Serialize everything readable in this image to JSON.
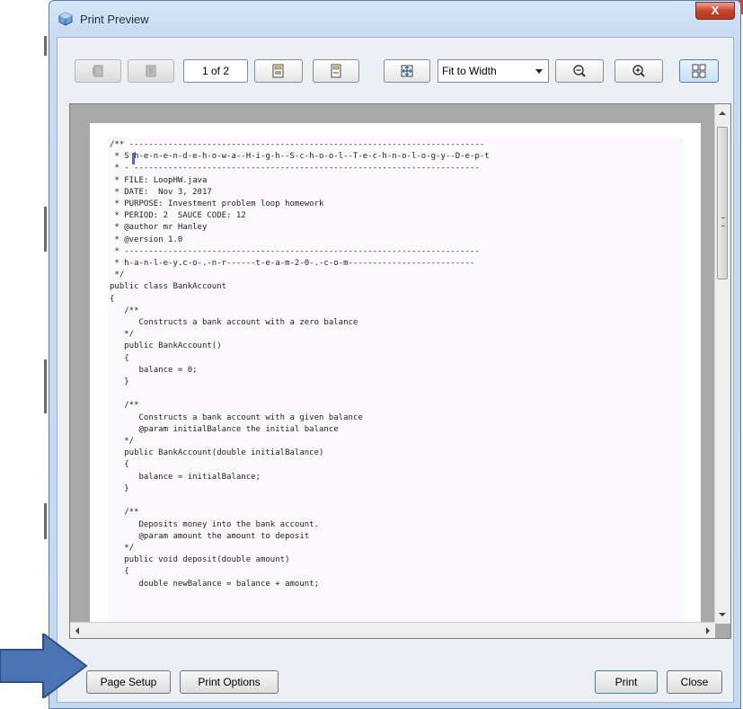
{
  "window": {
    "title": "Print Preview",
    "close_label": "X"
  },
  "toolbar": {
    "page_indicator": "1 of 2",
    "zoom_selected": "Fit to Width"
  },
  "preview": {
    "code_lines": [
      "/** -------------------------------------------------------------------------",
      " * S h-e-n-e-n-d-e-h-o-w-a--H-i-g-h--S-c-h-o-o-l--T-e-c-h-n-o-l-o-g-y--D-e-p-t",
      " * - -----------------------------------------------------------------------",
      " * FILE: LoopHW.java",
      " * DATE:  Nov 3, 2017",
      " * PURPOSE: Investment problem loop homework",
      " * PERIOD: 2  SAUCE CODE: 12",
      " * @author mr Hanley",
      " * @version 1.0",
      " * -------------------------------------------------------------------------",
      " * h-a-n-l-e-y.c-o-.-n-r------t-e-a-m-2-0-.-c-o-m--------------------------",
      " */",
      "public class BankAccount",
      "{",
      "   /**",
      "      Constructs a bank account with a zero balance",
      "   */",
      "   public BankAccount()",
      "   {",
      "      balance = 0;",
      "   }",
      "",
      "   /**",
      "      Constructs a bank account with a given balance",
      "      @param initialBalance the initial balance",
      "   */",
      "   public BankAccount(double initialBalance)",
      "   {",
      "      balance = initialBalance;",
      "   }",
      "",
      "   /**",
      "      Deposits money into the bank account.",
      "      @param amount the amount to deposit",
      "   */",
      "   public void deposit(double amount)",
      "   {",
      "      double newBalance = balance + amount;"
    ]
  },
  "buttons": {
    "page_setup": "Page Setup",
    "print_options": "Print Options",
    "print": "Print",
    "close": "Close"
  },
  "colors": {
    "arrow": "#4a74b4",
    "window_frame": "#c4d8ef"
  }
}
